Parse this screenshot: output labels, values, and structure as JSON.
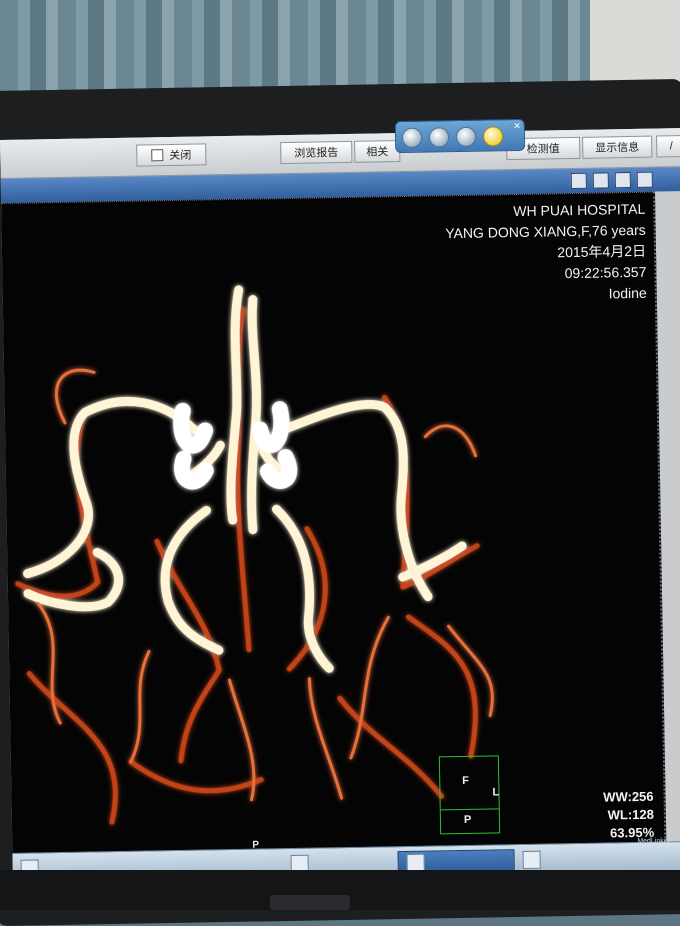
{
  "toolbar": {
    "close_label": "关闭",
    "report_label": "浏览报告",
    "related_label": "相关",
    "value_label": "检测值",
    "show_info_label": "显示信息",
    "extra_label": "/"
  },
  "overlay": {
    "hospital": "WH PUAI HOSPITAL",
    "patient": "YANG DONG XIANG,F,76 years",
    "date": "2015年4月2日",
    "time": "09:22:56.357",
    "contrast": "Iodine"
  },
  "orientation": {
    "top": "F",
    "right": "L",
    "bottom": "P",
    "viewer_bottom": "P"
  },
  "window": {
    "ww": "WW:256",
    "wl": "WL:128",
    "zoom": "63.95%"
  },
  "watermark": "MedLinker",
  "colors": {
    "vessel_core": "#fff6dc",
    "vessel_glow": "#d8541a",
    "background": "#050405",
    "overlay_green": "#2ec12e"
  }
}
